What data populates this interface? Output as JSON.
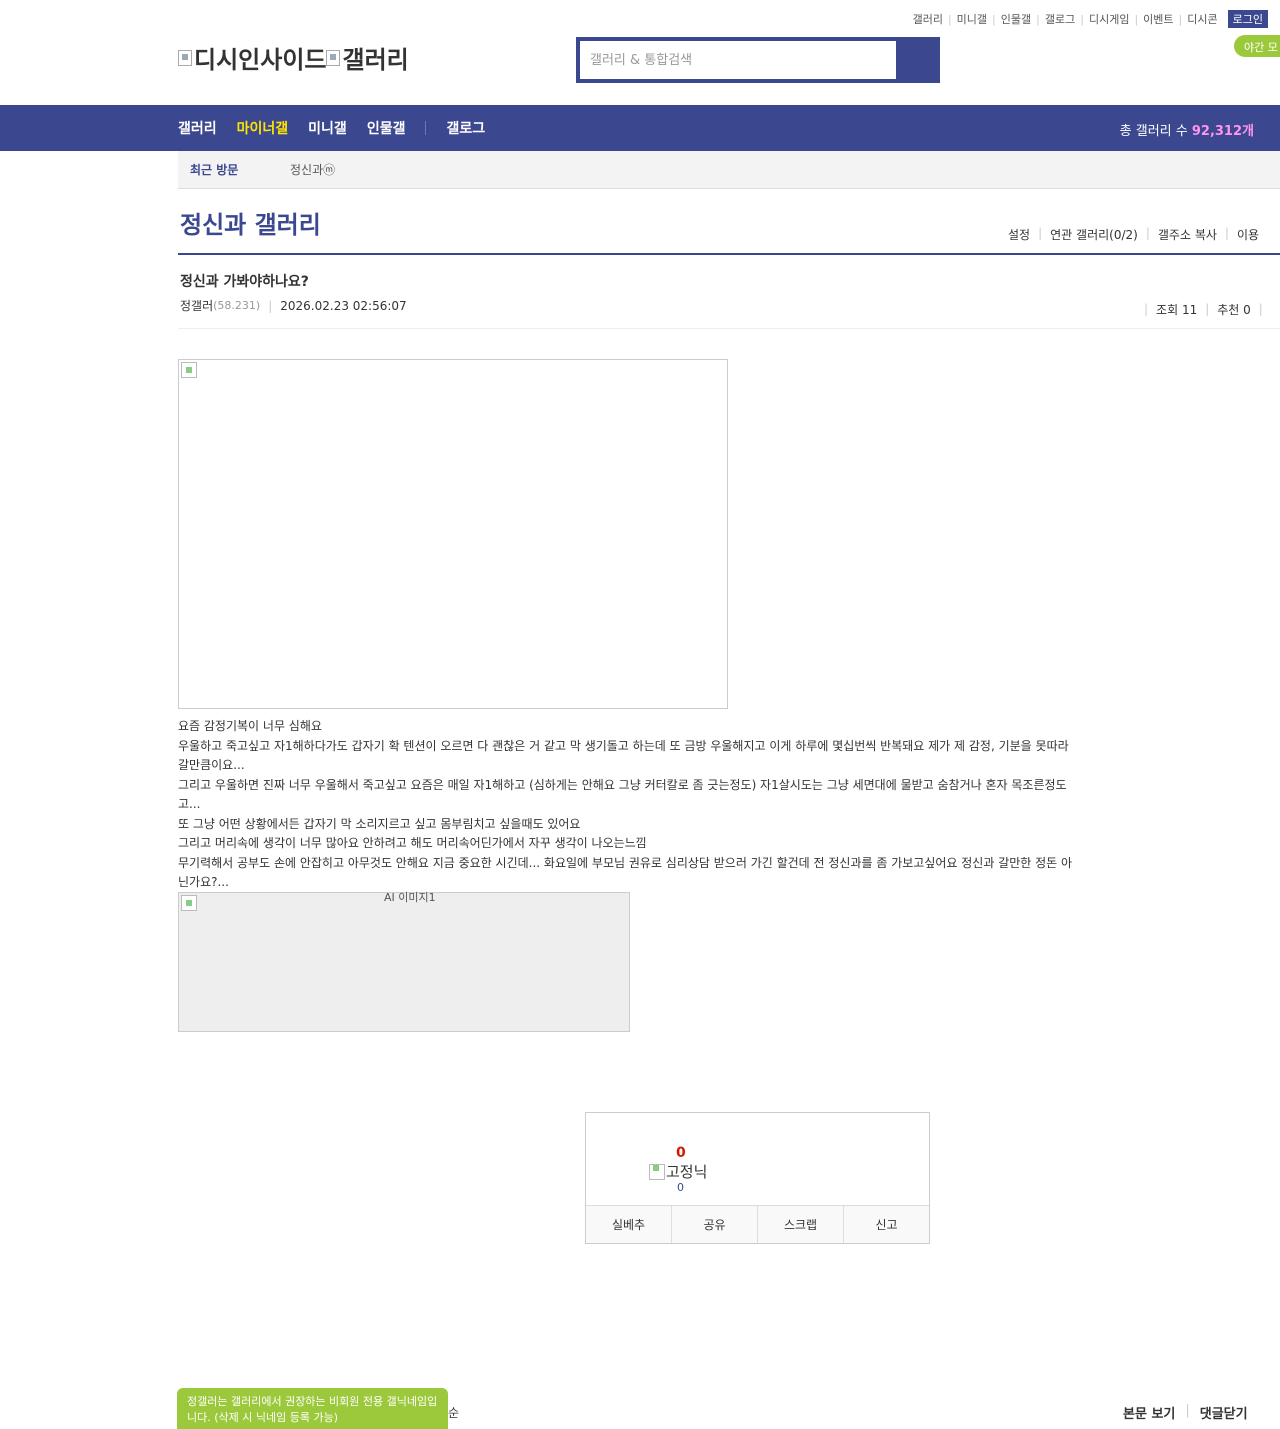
{
  "util": {
    "links": [
      "갤러리",
      "미니갤",
      "인물갤",
      "갤로그",
      "디시게임",
      "이벤트",
      "디시콘"
    ],
    "login": "로그인",
    "night_mode": "야간 모"
  },
  "logo": {
    "site": "디시인사이드",
    "section": "갤러리"
  },
  "search": {
    "placeholder": "갤러리 & 통합검색"
  },
  "gnb": {
    "items": [
      "갤러리",
      "마이너갤",
      "미니갤",
      "인물갤",
      "갤로그"
    ],
    "total_label": "총 갤러리 수",
    "total_value": "92,312개"
  },
  "recent": {
    "label": "최근 방문",
    "gallery": "정신과ⓜ"
  },
  "gallery_title": "정신과 갤러리",
  "subtools": [
    "설정",
    "연관 갤러리(0/2)",
    "갤주소 복사",
    "이용"
  ],
  "post": {
    "title": "정신과 가봐야하나요?",
    "writer": "정갤러",
    "ip": "(58.231)",
    "date": "2026.02.23 02:56:07",
    "views_label": "조회 11",
    "recommend_label": "추천 0",
    "body": [
      "요즘 감정기복이 너무 심해요",
      "우울하고 죽고싶고 자1해하다가도 갑자기 확 텐션이 오르면 다 괜찮은 거 같고 막 생기돌고 하는데 또 금방 우울해지고 이게 하루에 몇십번씩 반복돼요 제가 제 감정, 기분을 못따라갈만큼이요...",
      "그리고 우울하면 진짜 너무 우울해서 죽고싶고 요즘은 매일 자1해하고 (심하게는 안해요 그냥 커터칼로 좀 긋는정도) 자1살시도는 그냥 세면대에 물받고 숨참거나 혼자 목조른정도고...",
      "또 그냥 어떤 상황에서든 갑자기 막 소리지르고 싶고 몸부림치고 싶을때도 있어요",
      "그리고 머리속에 생각이 너무 많아요 안하려고 해도 머리속어딘가에서 자꾸 생각이 나오는느낌",
      "무기력해서 공부도 손에 안잡히고 아무것도 안해요 지금 중요한 시긴데... 화요일에 부모님 권유로 심리상담 받으러 가긴 할건데 전 정신과를 좀 가보고싶어요 정신과 갈만한 정돈 아닌가요?..."
    ],
    "image2_alt": "AI 이미지1"
  },
  "reco": {
    "count": "0",
    "nick_label": "고정닉",
    "fixed_count": "0",
    "buttons": [
      "실베추",
      "공유",
      "스크랩",
      "신고"
    ]
  },
  "toast": {
    "text": "정갤러는 갤러리에서 권장하는 비회원 전용 갤닉네임입니다. (삭제 시 닉네임 등록 가능)",
    "tail": "순"
  },
  "footer": {
    "view_body": "본문 보기",
    "close_comments": "댓글닫기"
  }
}
